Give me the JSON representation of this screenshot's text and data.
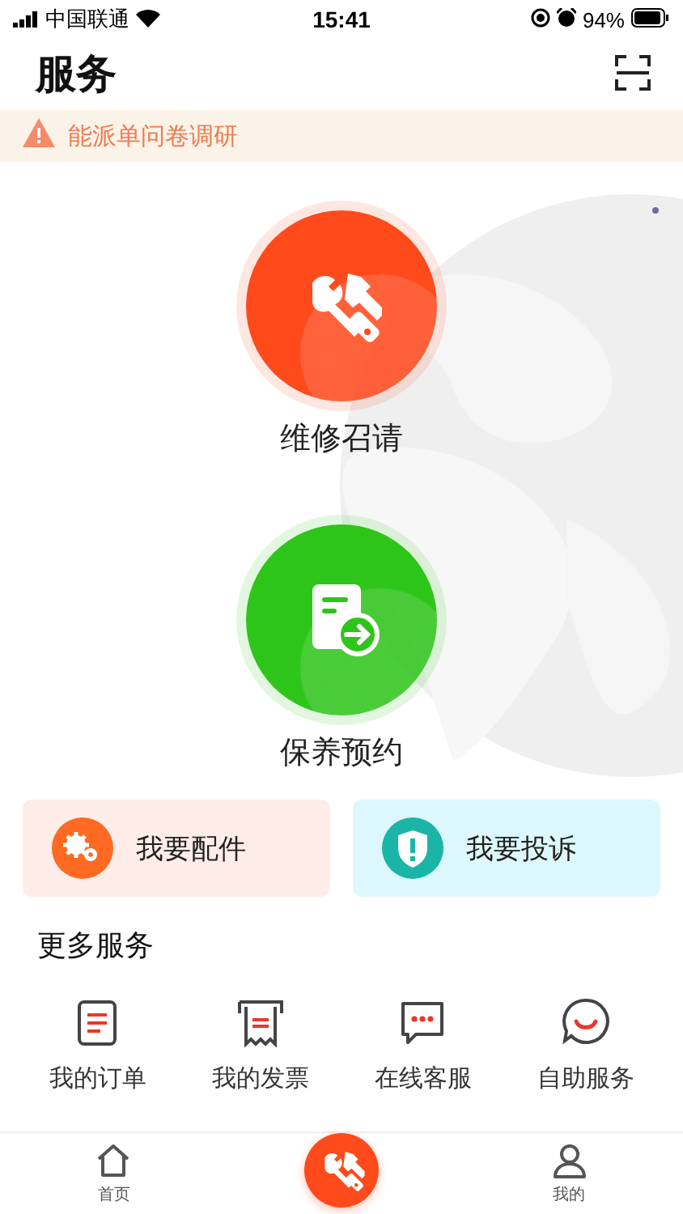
{
  "status_bar": {
    "carrier": "中国联通",
    "time": "15:41",
    "battery": "94%"
  },
  "header": {
    "title": "服务"
  },
  "notice": {
    "text": "能派单问卷调研"
  },
  "main_services": [
    {
      "kind": "repair",
      "label": "维修召请",
      "color": "#ff4a1c"
    },
    {
      "kind": "maintenance",
      "label": "保养预约",
      "color": "#2ec51a"
    }
  ],
  "quick_actions": [
    {
      "kind": "parts",
      "label": "我要配件",
      "color": "#ff6a22"
    },
    {
      "kind": "complaint",
      "label": "我要投诉",
      "color": "#1bb5a8"
    }
  ],
  "more_services": {
    "title": "更多服务",
    "items": [
      {
        "kind": "order",
        "label": "我的订单"
      },
      {
        "kind": "invoice",
        "label": "我的发票"
      },
      {
        "kind": "chat",
        "label": "在线客服"
      },
      {
        "kind": "self",
        "label": "自助服务"
      }
    ]
  },
  "tab_bar": [
    {
      "kind": "home",
      "label": "首页"
    },
    {
      "kind": "service"
    },
    {
      "kind": "profile",
      "label": "我的"
    }
  ]
}
